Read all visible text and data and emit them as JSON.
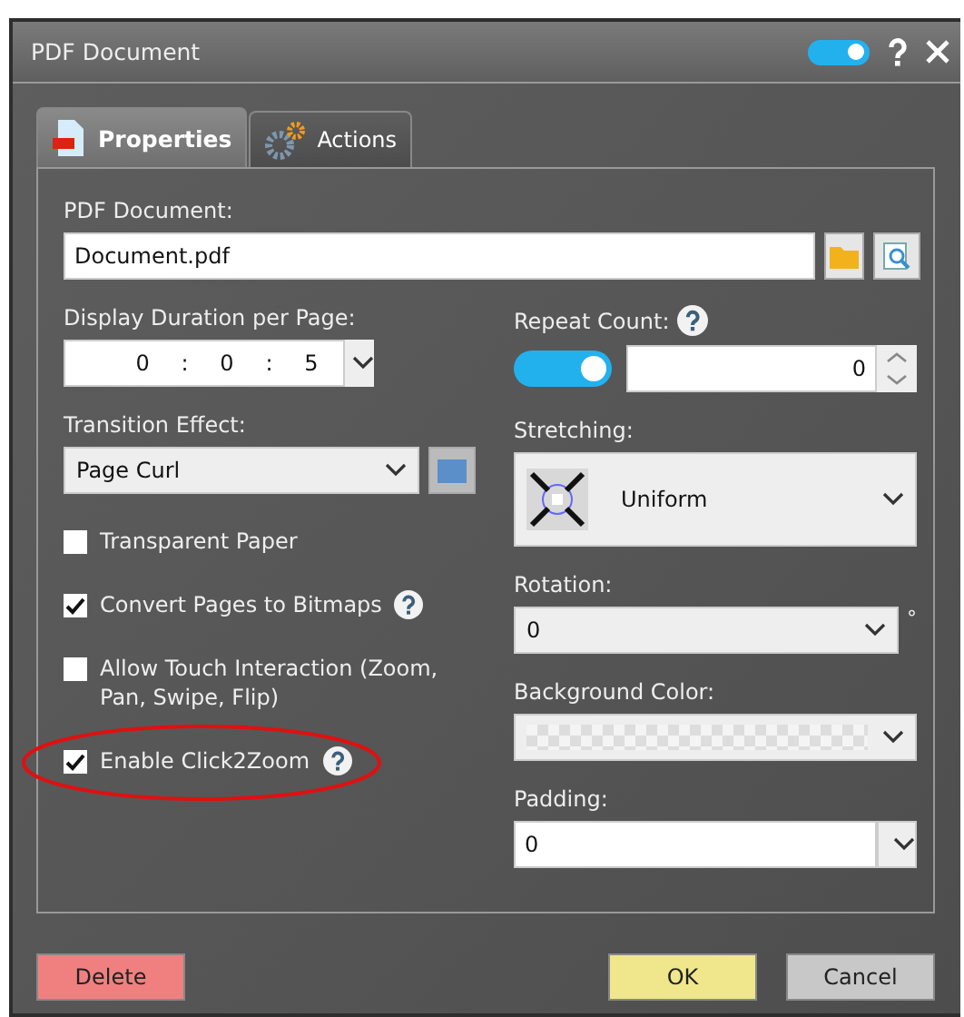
{
  "window": {
    "title": "PDF Document",
    "toggle_on": true
  },
  "tabs": [
    {
      "label": "Properties",
      "selected": true,
      "kind": "pdf"
    },
    {
      "label": "Actions",
      "selected": false,
      "kind": "gear"
    }
  ],
  "pdf_document": {
    "label": "PDF Document:",
    "value": "Document.pdf"
  },
  "display_duration": {
    "label": "Display Duration per Page:",
    "segments": [
      {
        "value": "0",
        "sep": ":"
      },
      {
        "value": "0",
        "sep": ":"
      },
      {
        "value": "5"
      }
    ]
  },
  "transition_effect": {
    "label": "Transition Effect:",
    "value": "Page Curl"
  },
  "checkboxes": [
    {
      "label": "Transparent Paper",
      "checked": false,
      "help": false,
      "highlighted": false
    },
    {
      "label": "Convert Pages to Bitmaps",
      "checked": true,
      "help": true,
      "highlighted": false
    },
    {
      "label": "Allow Touch Interaction (Zoom, Pan, Swipe, Flip)",
      "checked": false,
      "help": false,
      "highlighted": false
    },
    {
      "label": "Enable Click2Zoom",
      "checked": true,
      "help": true,
      "highlighted": true
    }
  ],
  "repeat_count": {
    "label": "Repeat Count:",
    "on": true,
    "value": "0"
  },
  "stretching": {
    "label": "Stretching:",
    "value": "Uniform"
  },
  "rotation": {
    "label": "Rotation:",
    "value": "0",
    "unit": "°"
  },
  "background_color": {
    "label": "Background Color:",
    "kind": "transparent"
  },
  "padding": {
    "label": "Padding:",
    "value": "0"
  },
  "left_buttons": [
    {
      "label": "Delete",
      "color": "#f08080"
    }
  ],
  "right_buttons": [
    {
      "label": "OK",
      "color": "#f0e68c"
    },
    {
      "label": "Cancel",
      "color": "#c8c8c8"
    }
  ]
}
